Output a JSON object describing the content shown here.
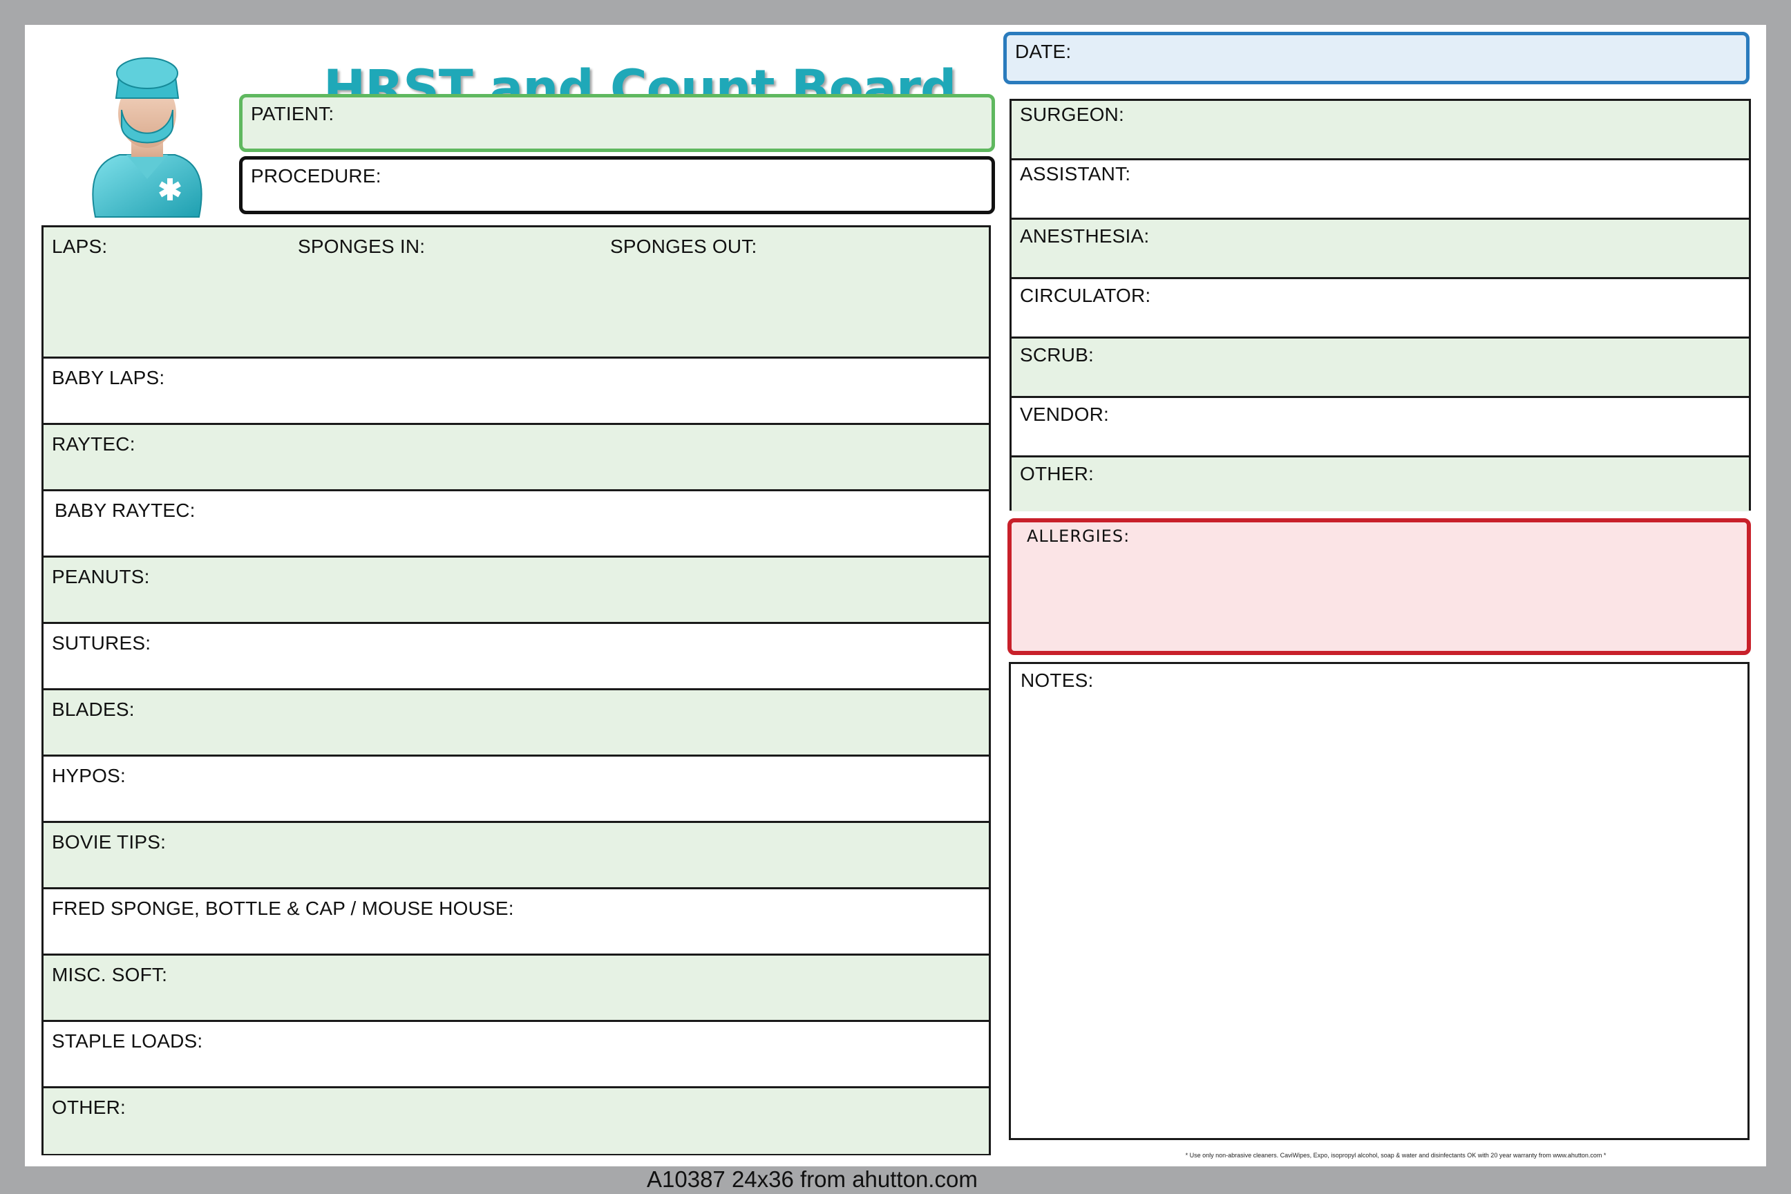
{
  "title": "HRST and Count Board",
  "header_fields": {
    "date": "DATE:",
    "patient": "PATIENT:",
    "procedure": "PROCEDURE:"
  },
  "count_section": {
    "laps": "LAPS:",
    "sponges_in": "SPONGES IN:",
    "sponges_out": "SPONGES OUT:",
    "rows": [
      "BABY LAPS:",
      "RAYTEC:",
      "BABY RAYTEC:",
      "PEANUTS:",
      "SUTURES:",
      "BLADES:",
      "HYPOS:",
      "BOVIE TIPS:",
      "FRED SPONGE, BOTTLE & CAP / MOUSE HOUSE:",
      "MISC. SOFT:",
      "STAPLE LOADS:",
      "OTHER:"
    ]
  },
  "staff_section": {
    "rows": [
      "SURGEON:",
      "ASSISTANT:",
      "ANESTHESIA:",
      "CIRCULATOR:",
      "SCRUB:",
      "VENDOR:",
      "OTHER:"
    ]
  },
  "allergies": "ALLERGIES:",
  "notes": "NOTES:",
  "footer_note": "* Use only non-abrasive cleaners. CaviWipes, Expo, isopropyl alcohol, soap & water and disinfectants OK with 20 year warranty from www.ahutton.com *",
  "footer": "A10387  24x36 from ahutton.com",
  "colors": {
    "title": "#1fa8b8",
    "patient_border": "#5fb85f",
    "date_border": "#2a7bbd",
    "date_fill": "#e3eef8",
    "allergies_border": "#c8202a",
    "allergies_fill": "#fbe4e6",
    "row_green": "#e6f2e4"
  },
  "icons": [
    "surgeon-icon"
  ]
}
